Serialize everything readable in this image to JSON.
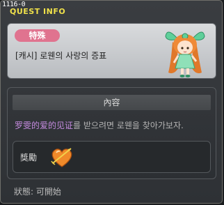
{
  "window": {
    "quest_id": "1116-0",
    "title": "QUEST INFO"
  },
  "quest": {
    "category_badge": "特殊",
    "name": "[캐시] 로웬의 사랑의 증표",
    "npc_portrait": "npc-girl-green-ribbon"
  },
  "details": {
    "section_header": "內容",
    "description_highlight": "罗雯的爱的见证",
    "description_rest": "를 받으려면 로웬을 찾아가보자."
  },
  "reward": {
    "label": "獎勵",
    "item_icon": "heart-arrow-icon"
  },
  "status": {
    "text": "狀態:  可開始"
  },
  "colors": {
    "title": "#f0e14a",
    "badge": "#e0738f",
    "highlight": "#c58be0"
  }
}
